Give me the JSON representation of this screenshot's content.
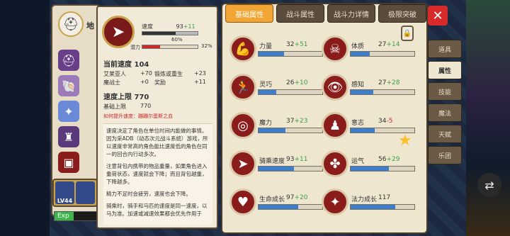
{
  "left_panel": {
    "char_name": "地",
    "char_avatar_icon": "helmet-icon",
    "equipment": [
      {
        "icon": "helmet-icon",
        "color": "#6a3f8a"
      },
      {
        "icon": "shell-icon",
        "color": "#9a7ab8"
      },
      {
        "icon": "wing-icon",
        "color": "#6a8ad8"
      },
      {
        "icon": "armor-icon",
        "color": "#5a3a7a"
      },
      {
        "icon": "chest-icon",
        "color": "#8a1c1c"
      }
    ],
    "pets": [
      {
        "level": "LV44"
      },
      {
        "level": ""
      }
    ],
    "exp_label": "Exp",
    "exp_fraction": 0.12
  },
  "tooltip": {
    "title": "速度",
    "value": "93",
    "bonus": "+11",
    "pct": "60%",
    "pct_fraction": 0.6,
    "potential_label": "潜力",
    "potential_pct": "32%",
    "potential_fraction": 0.32,
    "current_title": "当前速度",
    "current_value": "104",
    "current_rows": [
      {
        "name": "艾莱亚人",
        "val": "+70",
        "name2": "锻炼或重生",
        "val2": "+23"
      },
      {
        "name": "魔战士",
        "val": "+0",
        "name2": "奖励",
        "val2": "+11"
      }
    ],
    "limit_title": "速度上限",
    "limit_value": "770",
    "limit_rows": [
      {
        "name": "基础上限",
        "val": "770"
      }
    ],
    "hint": "如何提升速度：蹦蹦尔蛋斯之血",
    "desc": [
      "速度决定了角色在单位时间内能做的事情。因为采ADB（动态次元战斗系统）游戏，所以速度非常高的角色能比速度低的角色在同一的回合内行动多次。",
      "注意背包内携带的物品重量，如果角色进入重荷状态，速度就会下降；而且背包越重，下降越多。",
      "精力不足时会疲劳，速度也会下降。",
      "骑乘时，骑手和马匹的速度是同一速度，以马为准。加速或减速效果都会优先作用于"
    ]
  },
  "tabs": [
    "基础属性",
    "战斗属性",
    "战斗力详情",
    "极限突破"
  ],
  "active_tab": 0,
  "attributes": [
    {
      "name": "力量",
      "val": "32",
      "bonus": "+51",
      "bonus_color": "green",
      "fill": 0.4,
      "icon": "arm-icon"
    },
    {
      "name": "体质",
      "val": "27",
      "bonus": "+14",
      "bonus_color": "green",
      "fill": 0.3,
      "icon": "body-icon"
    },
    {
      "name": "灵巧",
      "val": "26",
      "bonus": "+10",
      "bonus_color": "green",
      "fill": 0.28,
      "icon": "runner-icon"
    },
    {
      "name": "感知",
      "val": "27",
      "bonus": "+28",
      "bonus_color": "green",
      "fill": 0.36,
      "icon": "eye-icon"
    },
    {
      "name": "魔力",
      "val": "37",
      "bonus": "+23",
      "bonus_color": "green",
      "fill": 0.42,
      "icon": "swirl-icon"
    },
    {
      "name": "意志",
      "val": "34",
      "bonus": "-5",
      "bonus_color": "red",
      "fill": 0.38,
      "icon": "figure-icon"
    },
    {
      "name": "骑乘速度",
      "val": "93",
      "bonus": "+11",
      "bonus_color": "green",
      "fill": 0.55,
      "icon": "speed-icon"
    },
    {
      "name": "运气",
      "val": "56",
      "bonus": "+29",
      "bonus_color": "green",
      "fill": 0.6,
      "icon": "clover-icon"
    },
    {
      "name": "生命成长",
      "val": "97",
      "bonus": "+20",
      "bonus_color": "green",
      "fill": 0.62,
      "icon": "heart-icon"
    },
    {
      "name": "法力成长",
      "val": "117",
      "bonus": "",
      "bonus_color": "green",
      "fill": 0.7,
      "icon": "magic-icon"
    }
  ],
  "side_menu": [
    "道具",
    "属性",
    "技能",
    "魔法",
    "天赋",
    "乐团"
  ],
  "side_active": 1
}
